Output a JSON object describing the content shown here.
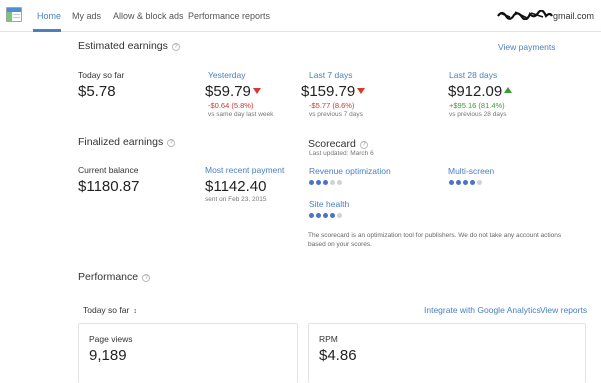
{
  "nav": {
    "tabs": [
      "Home",
      "My ads",
      "Allow & block ads",
      "Performance reports"
    ],
    "account_suffix": "gmail.com"
  },
  "estimated": {
    "title": "Estimated earnings",
    "view_payments": "View payments",
    "today_label": "Today so far",
    "today_value": "$5.78",
    "yesterday_label": "Yesterday",
    "yesterday_value": "$59.79",
    "yesterday_delta": "-$0.64 (5.8%)",
    "yesterday_compare": "vs same day last week",
    "last7_label": "Last 7 days",
    "last7_value": "$159.79",
    "last7_delta": "-$5.77 (8.6%)",
    "last7_compare": "vs previous 7 days",
    "last28_label": "Last 28 days",
    "last28_value": "$912.09",
    "last28_delta": "+$95.16 (81.4%)",
    "last28_compare": "vs previous 28 days"
  },
  "finalized": {
    "title": "Finalized earnings",
    "balance_label": "Current balance",
    "balance_value": "$1180.87",
    "recent_label": "Most recent payment",
    "recent_value": "$1142.40",
    "recent_date": "sent on Feb 23, 2015"
  },
  "scorecard": {
    "title": "Scorecard",
    "updated": "Last updated: March 6",
    "revenue_label": "Revenue optimization",
    "revenue_score": 3,
    "multiscreen_label": "Multi-screen",
    "multiscreen_score": 4,
    "site_health_label": "Site health",
    "site_health_score": 4,
    "max_score": 5,
    "note": "The scorecard is an optimization tool for publishers. We do not take any account actions based on your scores."
  },
  "performance": {
    "title": "Performance",
    "range": "Today so far",
    "integrate_link": "Integrate with Google Analytics",
    "view_reports": "View reports",
    "page_views_label": "Page views",
    "page_views_value": "9,189",
    "rpm_label": "RPM",
    "rpm_value": "$4.86"
  },
  "colors": {
    "accent": "#4a7fc1",
    "negative": "#d23a2f",
    "positive": "#3a9b3a",
    "score_on": "#4a74c9",
    "score_off": "#cfd3d8"
  }
}
